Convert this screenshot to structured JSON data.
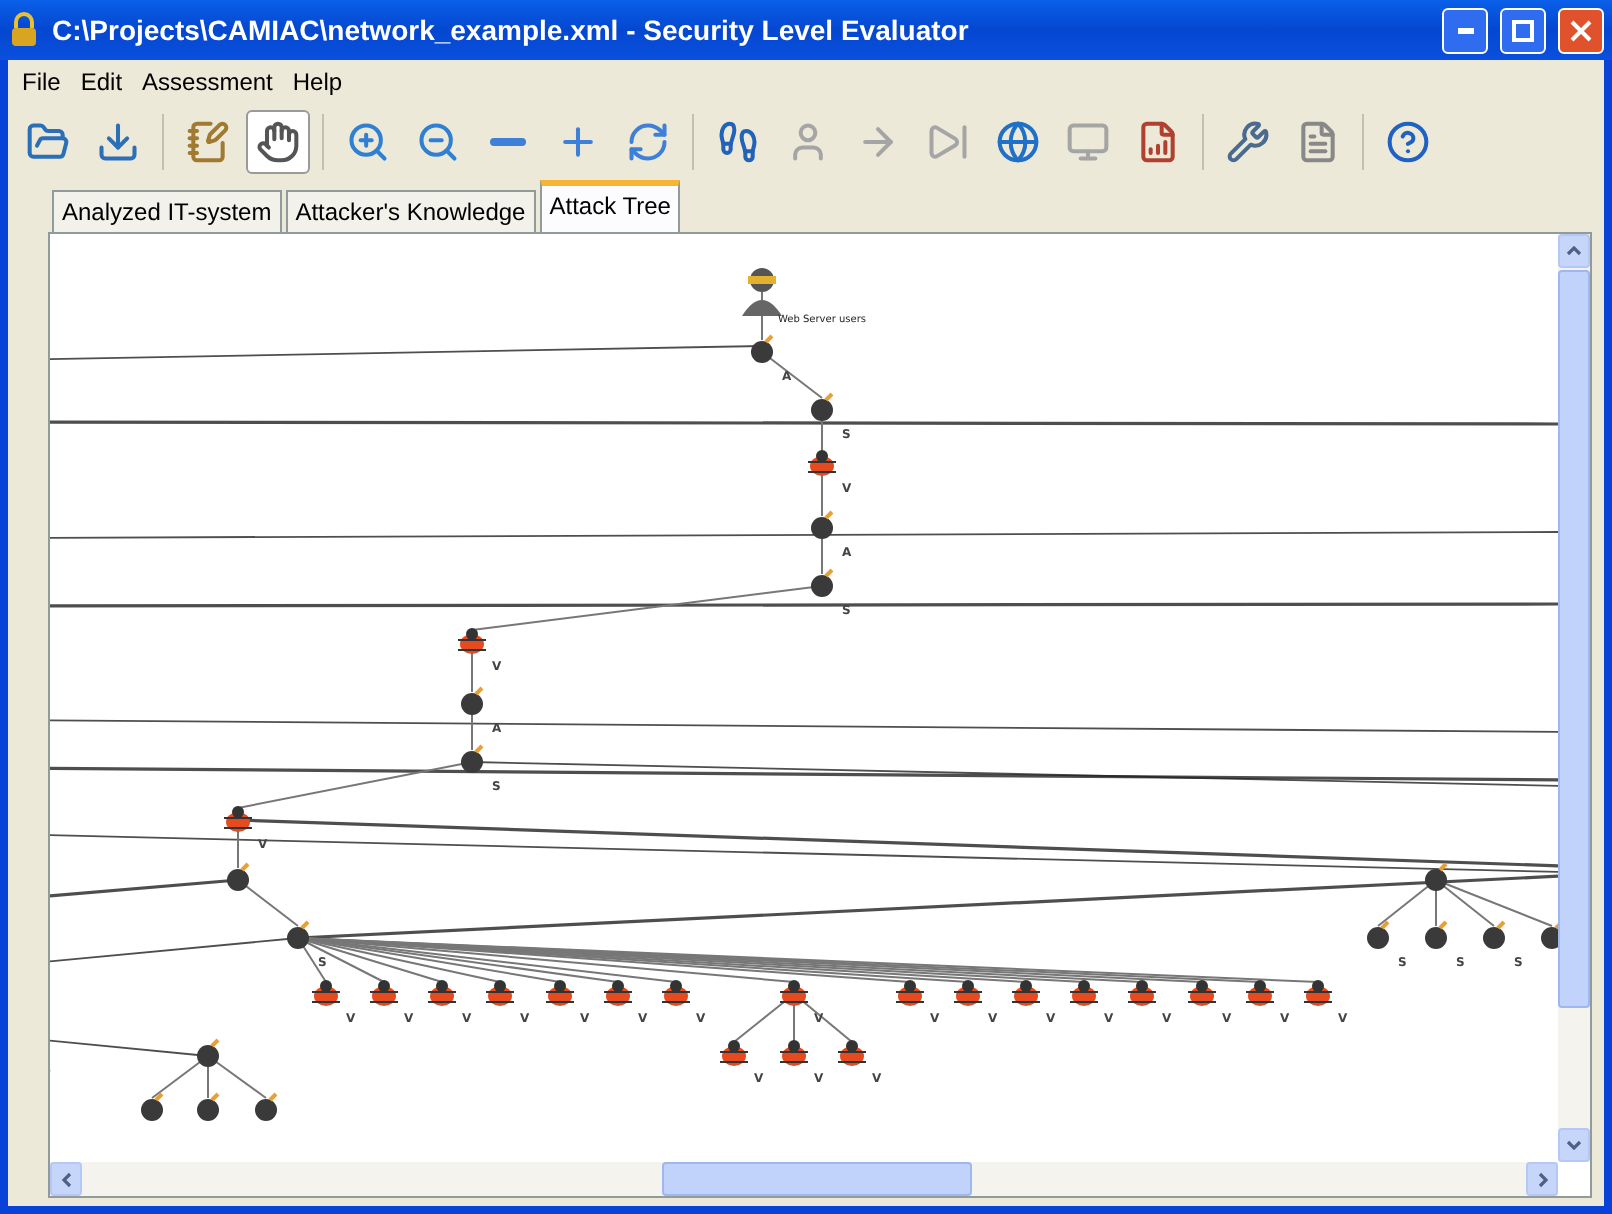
{
  "window": {
    "title": "C:\\Projects\\CAMIAC\\network_example.xml - Security Level Evaluator"
  },
  "menu": [
    "File",
    "Edit",
    "Assessment",
    "Help"
  ],
  "toolbar": [
    {
      "kind": "open",
      "selected": false,
      "disabled": false
    },
    {
      "kind": "import",
      "selected": false,
      "disabled": false
    },
    {
      "kind": "separator"
    },
    {
      "kind": "edit",
      "selected": false,
      "disabled": false
    },
    {
      "kind": "hand",
      "selected": true,
      "disabled": false
    },
    {
      "kind": "separator"
    },
    {
      "kind": "zoomin",
      "selected": false,
      "disabled": false
    },
    {
      "kind": "zoomout",
      "selected": false,
      "disabled": false
    },
    {
      "kind": "minus",
      "selected": false,
      "disabled": false
    },
    {
      "kind": "plus",
      "selected": false,
      "disabled": false
    },
    {
      "kind": "refresh",
      "selected": false,
      "disabled": false
    },
    {
      "kind": "separator"
    },
    {
      "kind": "footprints",
      "selected": false,
      "disabled": false
    },
    {
      "kind": "person",
      "selected": false,
      "disabled": true
    },
    {
      "kind": "arrow",
      "selected": false,
      "disabled": true
    },
    {
      "kind": "skip",
      "selected": false,
      "disabled": true
    },
    {
      "kind": "globe",
      "selected": false,
      "disabled": false
    },
    {
      "kind": "monitor",
      "selected": false,
      "disabled": true
    },
    {
      "kind": "report",
      "selected": false,
      "disabled": false
    },
    {
      "kind": "separator"
    },
    {
      "kind": "tools",
      "selected": false,
      "disabled": false
    },
    {
      "kind": "document",
      "selected": false,
      "disabled": false
    },
    {
      "kind": "separator"
    },
    {
      "kind": "help",
      "selected": false,
      "disabled": false
    }
  ],
  "tabs": [
    {
      "label": "Analyzed IT-system",
      "selected": false
    },
    {
      "label": "Attacker's Knowledge",
      "selected": false
    },
    {
      "label": "Attack Tree",
      "selected": true
    }
  ],
  "tree": {
    "nodes": [
      {
        "kind": "attacker",
        "label": "Web Server users"
      },
      {
        "kind": "bomb",
        "label": "A"
      },
      {
        "kind": "bomb",
        "label": "S"
      },
      {
        "kind": "bug",
        "label": "V"
      },
      {
        "kind": "bomb",
        "label": "A"
      },
      {
        "kind": "bomb",
        "label": "S"
      },
      {
        "kind": "bug",
        "label": "V"
      },
      {
        "kind": "bomb",
        "label": "A"
      },
      {
        "kind": "bomb",
        "label": "S"
      },
      {
        "kind": "bug",
        "label": "V"
      },
      {
        "kind": "bomb"
      },
      {
        "kind": "bomb",
        "label": "S"
      },
      {
        "kind": "bug",
        "label": "V"
      },
      {
        "kind": "bug",
        "label": "V"
      },
      {
        "kind": "bug",
        "label": "V"
      },
      {
        "kind": "bug",
        "label": "V"
      },
      {
        "kind": "bug",
        "label": "V"
      },
      {
        "kind": "bug",
        "label": "V"
      },
      {
        "kind": "bug",
        "label": "V"
      },
      {
        "kind": "bug",
        "label": "V"
      },
      {
        "kind": "bug",
        "label": "V"
      },
      {
        "kind": "bug",
        "label": "V"
      },
      {
        "kind": "bug",
        "label": "V"
      },
      {
        "kind": "bug",
        "label": "V"
      },
      {
        "kind": "bug",
        "label": "V"
      },
      {
        "kind": "bug",
        "label": "V"
      },
      {
        "kind": "bug",
        "label": "V"
      },
      {
        "kind": "bug",
        "label": "V"
      },
      {
        "kind": "bug",
        "label": "V"
      },
      {
        "kind": "bug",
        "label": "V"
      },
      {
        "kind": "bug",
        "label": "V"
      },
      {
        "kind": "bomb"
      },
      {
        "kind": "bomb",
        "label": "S"
      },
      {
        "kind": "bomb",
        "label": "S"
      },
      {
        "kind": "bomb",
        "label": "S"
      },
      {
        "kind": "bomb"
      },
      {
        "kind": "bomb"
      },
      {
        "kind": "bomb"
      },
      {
        "kind": "bomb"
      },
      {
        "kind": "bomb"
      }
    ]
  }
}
